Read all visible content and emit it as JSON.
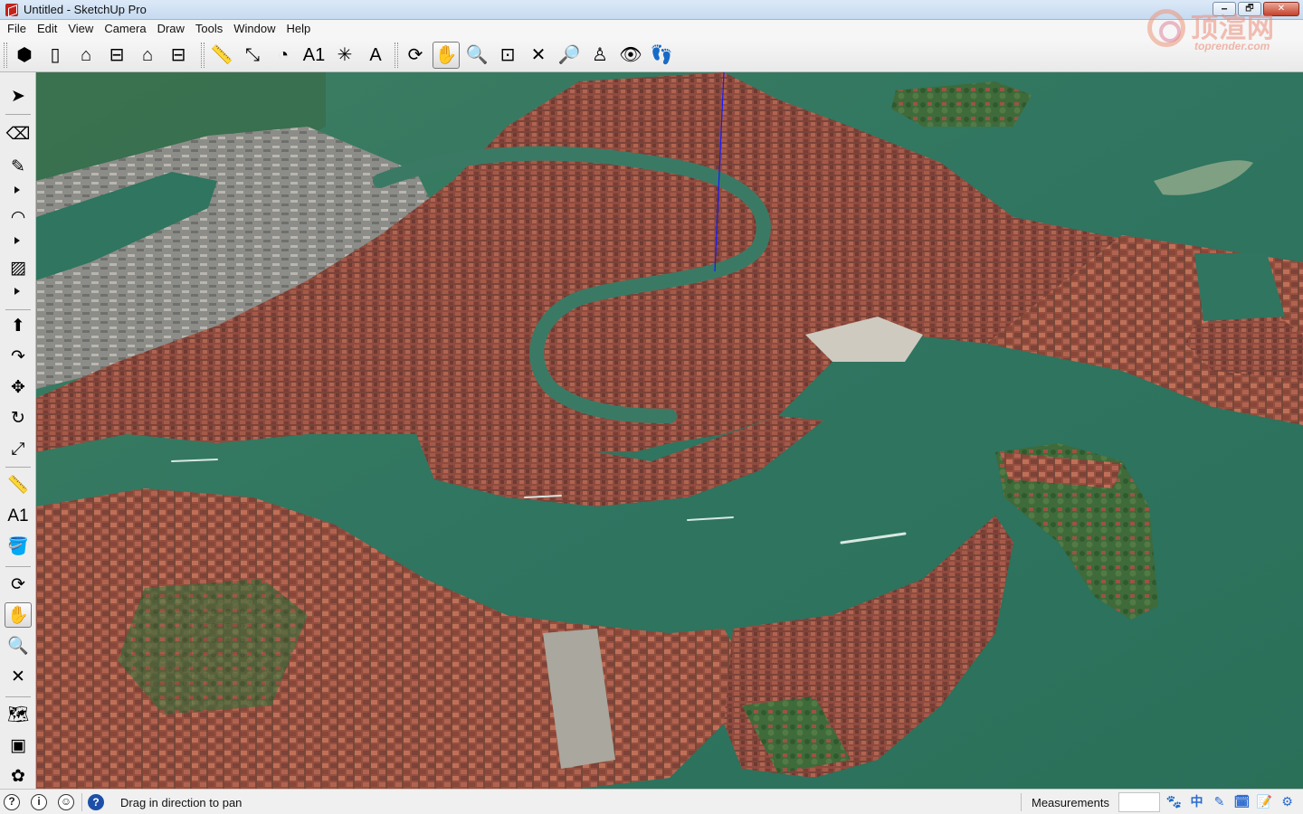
{
  "window": {
    "title": "Untitled - SketchUp Pro",
    "minimize_label": "🗕",
    "restore_label": "🗗",
    "close_label": "✕"
  },
  "watermark": {
    "cn": "顶渲网",
    "en": "toprender.com"
  },
  "menu": [
    "File",
    "Edit",
    "View",
    "Camera",
    "Draw",
    "Tools",
    "Window",
    "Help"
  ],
  "toolbar": {
    "views": [
      {
        "name": "iso-view-icon",
        "glyph": "⬢"
      },
      {
        "name": "top-view-icon",
        "glyph": "▯"
      },
      {
        "name": "front-view-icon",
        "glyph": "⌂"
      },
      {
        "name": "right-view-icon",
        "glyph": "⊟"
      },
      {
        "name": "back-view-icon",
        "glyph": "⌂"
      },
      {
        "name": "left-view-icon",
        "glyph": "⊟"
      }
    ],
    "construction": [
      {
        "name": "tape-measure-icon",
        "glyph": "📏"
      },
      {
        "name": "dimension-icon",
        "glyph": "⤡"
      },
      {
        "name": "protractor-icon",
        "glyph": "◔"
      },
      {
        "name": "text-icon",
        "glyph": "A1"
      },
      {
        "name": "axes-icon",
        "glyph": "✳"
      },
      {
        "name": "3d-text-icon",
        "glyph": "A"
      }
    ],
    "camera": [
      {
        "name": "orbit-icon",
        "glyph": "⟳",
        "active": false
      },
      {
        "name": "pan-icon",
        "glyph": "✋",
        "active": true
      },
      {
        "name": "zoom-icon",
        "glyph": "🔍",
        "active": false
      },
      {
        "name": "zoom-window-icon",
        "glyph": "⊡",
        "active": false
      },
      {
        "name": "zoom-extents-icon",
        "glyph": "✕",
        "active": false
      },
      {
        "name": "previous-view-icon",
        "glyph": "🔎",
        "active": false
      },
      {
        "name": "position-camera-icon",
        "glyph": "♙",
        "active": false
      },
      {
        "name": "look-around-icon",
        "glyph": "👁",
        "active": false
      },
      {
        "name": "walk-icon",
        "glyph": "👣",
        "active": false
      }
    ]
  },
  "left_toolbar": [
    {
      "name": "select-icon",
      "glyph": "➤",
      "active": false
    },
    {
      "name": "eraser-icon",
      "glyph": "⌫",
      "active": false
    },
    {
      "name": "pencil-icon",
      "glyph": "✎",
      "active": false
    },
    {
      "name": "arc-icon",
      "glyph": "◠",
      "active": false
    },
    {
      "name": "rectangle-icon",
      "glyph": "▨",
      "active": false
    },
    {
      "name": "push-pull-icon",
      "glyph": "⬆",
      "active": false
    },
    {
      "name": "follow-me-icon",
      "glyph": "↷",
      "active": false
    },
    {
      "name": "move-icon",
      "glyph": "✥",
      "active": false
    },
    {
      "name": "rotate-icon",
      "glyph": "↻",
      "active": false
    },
    {
      "name": "scale-icon",
      "glyph": "⤢",
      "active": false
    },
    {
      "name": "tape-measure-icon",
      "glyph": "📏",
      "active": false
    },
    {
      "name": "text-icon",
      "glyph": "A1",
      "active": false
    },
    {
      "name": "paint-bucket-icon",
      "glyph": "🪣",
      "active": false
    },
    {
      "name": "orbit-icon",
      "glyph": "⟳",
      "active": false
    },
    {
      "name": "pan-icon",
      "glyph": "✋",
      "active": true
    },
    {
      "name": "zoom-icon",
      "glyph": "🔍",
      "active": false
    },
    {
      "name": "zoom-extents-icon",
      "glyph": "✕",
      "active": false
    },
    {
      "name": "map-icon",
      "glyph": "🗺",
      "active": false
    },
    {
      "name": "warehouse-icon",
      "glyph": "▣",
      "active": false
    },
    {
      "name": "extension-icon",
      "glyph": "✿",
      "active": false
    }
  ],
  "viewport": {
    "water_color": "#2f7560",
    "roof_color": "#8e4a3e",
    "axis_color": "#1a1aff"
  },
  "status": {
    "hint": "Drag in direction to pan",
    "measurements_label": "Measurements",
    "help_glyph": "?",
    "geo_glyph": "?",
    "credits_glyph": "i",
    "user_glyph": "☺",
    "ime": [
      "🐾",
      "中",
      "✎",
      "🗓",
      "📝",
      "⚙"
    ]
  }
}
